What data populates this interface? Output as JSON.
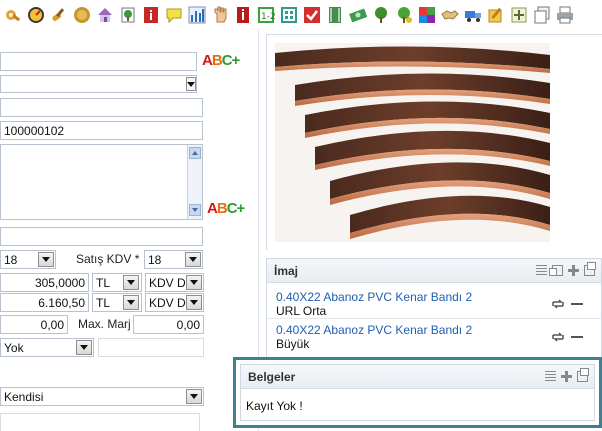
{
  "toolbar": {
    "icons": [
      "wrench-icon",
      "gauge-icon",
      "brush-icon",
      "coin-icon",
      "house-icon",
      "tree-doc-icon",
      "info-icon",
      "note-icon",
      "chart-icon",
      "hand-icon",
      "info-red-icon",
      "one-two-icon",
      "calculator-icon",
      "checklist-icon",
      "film-icon",
      "cash-icon",
      "tree-icon",
      "tree-money-icon",
      "color-grid-icon",
      "handshake-icon",
      "truck-icon",
      "edit-icon",
      "add-icon",
      "copy-icon",
      "print-icon"
    ]
  },
  "form": {
    "field_code": "100000102",
    "kdv_left_value": "18",
    "satis_kdv_label": "Satış KDV *",
    "satis_kdv_value": "18",
    "price1": "305,0000",
    "currency1": "TL",
    "kdv_type1": "KDV D",
    "price2": "6.160,50",
    "currency2": "TL",
    "kdv_type2": "KDV D",
    "min_value": "0,00",
    "max_marj_label": "Max. Marj",
    "max_marj_value": "0,00",
    "yok_value": "Yok",
    "kendisi_value": "Kendisi",
    "abc_label": "ABC+"
  },
  "imaj": {
    "title": "İmaj",
    "items": [
      {
        "link": "0.40X22 Abanoz PVC Kenar Bandı 2",
        "sub": "URL Orta"
      },
      {
        "link": "0.40X22 Abanoz PVC Kenar Bandı 2",
        "sub": "Büyük"
      }
    ]
  },
  "belgeler": {
    "title": "Belgeler",
    "empty_text": "Kayıt Yok !"
  },
  "colors": {
    "accent_border": "#3e7f92",
    "link": "#1f5fb0"
  }
}
